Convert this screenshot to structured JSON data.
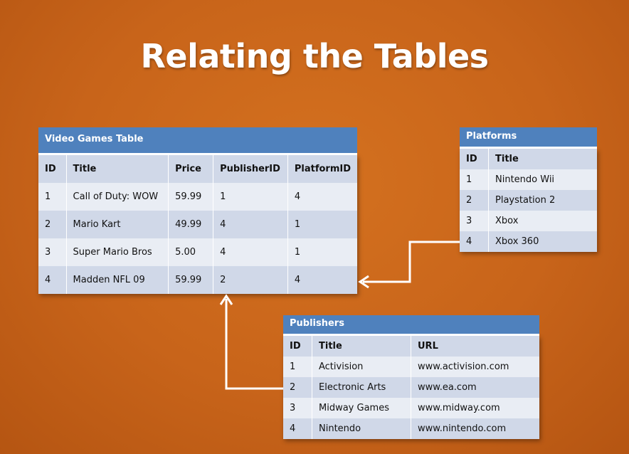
{
  "slide": {
    "title": "Relating the Tables"
  },
  "video_games": {
    "caption": "Video Games Table",
    "headers": [
      "ID",
      "Title",
      "Price",
      "PublisherID",
      "PlatformID"
    ],
    "rows": [
      [
        "1",
        "Call of Duty: WOW",
        "59.99",
        "1",
        "4"
      ],
      [
        "2",
        "Mario Kart",
        "49.99",
        "4",
        "1"
      ],
      [
        "3",
        "Super Mario Bros",
        "5.00",
        "4",
        "1"
      ],
      [
        "4",
        "Madden NFL 09",
        "59.99",
        "2",
        "4"
      ]
    ]
  },
  "platforms": {
    "caption": "Platforms",
    "headers": [
      "ID",
      "Title"
    ],
    "rows": [
      [
        "1",
        "Nintendo Wii"
      ],
      [
        "2",
        "Playstation 2"
      ],
      [
        "3",
        "Xbox"
      ],
      [
        "4",
        "Xbox 360"
      ]
    ]
  },
  "publishers": {
    "caption": "Publishers",
    "headers": [
      "ID",
      "Title",
      "URL"
    ],
    "rows": [
      [
        "1",
        "Activision",
        "www.activision.com"
      ],
      [
        "2",
        "Electronic Arts",
        "www.ea.com"
      ],
      [
        "3",
        "Midway Games",
        "www.midway.com"
      ],
      [
        "4",
        "Nintendo",
        "www.nintendo.com"
      ]
    ]
  },
  "colors": {
    "background": "#c8641a",
    "header_blue": "#4f81bd",
    "row_dark": "#d0d8e8",
    "row_light": "#e9edf4",
    "arrow": "#ffffff"
  }
}
